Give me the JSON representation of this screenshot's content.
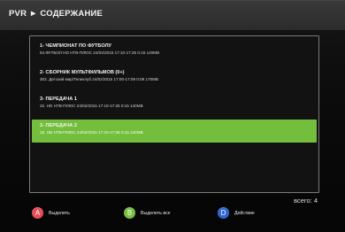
{
  "header": {
    "title": "PVR ► СОДЕРЖАНИЕ"
  },
  "list": {
    "items": [
      {
        "title": "1- ЧЕМПИОНАТ ПО ФУТБОЛУ",
        "meta": "54.ФУТБОЛ HD НТВ-ПЛЮС   24/02/2015 17:10-17:25  0:15   140MB",
        "selected": false
      },
      {
        "title": "2- СБОРНИК МУЛЬТФИЛЬМОВ (0+)",
        "meta": "302. Детский мир/Телеклуб   24/02/2015 17:00-17:09  0:09   170MB",
        "selected": false
      },
      {
        "title": "3- ПЕРЕДАЧА 1",
        "meta": "32. HD НТВ-ПЛЮС    24/02/2015 17:10-17:25  0:15   140MB",
        "selected": false
      },
      {
        "title": "2- ПЕРЕДАЧА 2",
        "meta": "33. HD НТВ-ПЛЮС    24/02/2015 17:10-17:25  0:15   140MB",
        "selected": true
      }
    ]
  },
  "footer": {
    "total": "всего: 4",
    "buttons": [
      {
        "key": "A",
        "label": "Выделить",
        "color": "#e84b5a"
      },
      {
        "key": "B",
        "label": "Выделить все",
        "color": "#75c13f"
      },
      {
        "key": "D",
        "label": "Действие",
        "color": "#2f66d6"
      }
    ]
  }
}
